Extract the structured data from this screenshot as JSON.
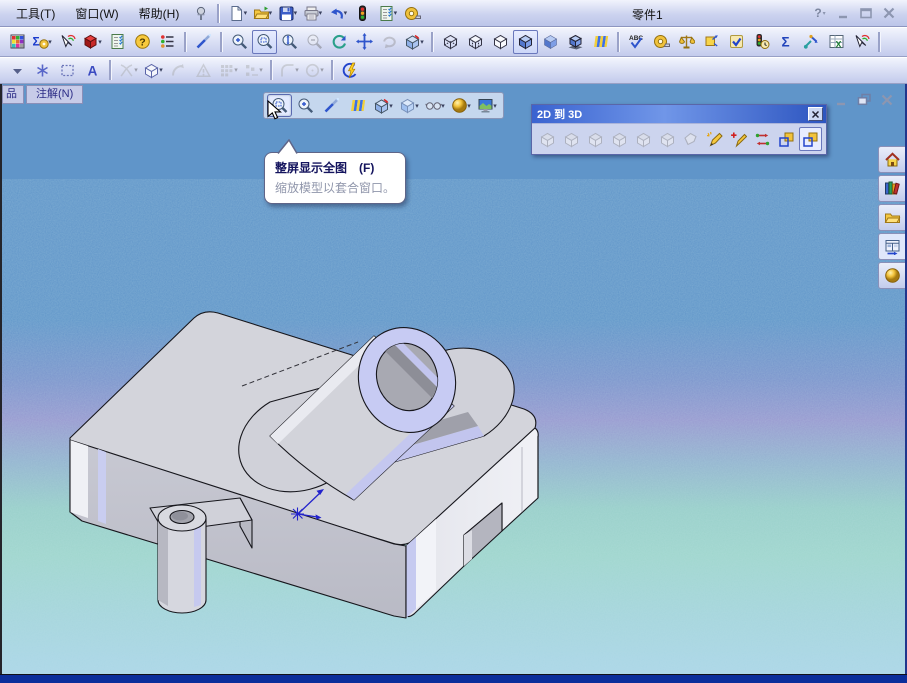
{
  "titlebar": {
    "title": "零件1",
    "menus": [
      {
        "label": "工具(T)"
      },
      {
        "label": "窗口(W)"
      },
      {
        "label": "帮助(H)"
      }
    ],
    "pin_icon": "pushpin",
    "window_buttons": [
      {
        "name": "help",
        "label": "?"
      },
      {
        "name": "minimize"
      },
      {
        "name": "maximize"
      },
      {
        "name": "close"
      }
    ]
  },
  "standard_toolbar": [
    {
      "icon": "new-doc",
      "dropdown": true
    },
    {
      "icon": "open-folder",
      "dropdown": true
    },
    {
      "icon": "save-floppy",
      "dropdown": true
    },
    {
      "icon": "print",
      "dropdown": true
    },
    {
      "icon": "undo",
      "dropdown": true
    },
    {
      "icon": "traffic-light"
    },
    {
      "icon": "checklist",
      "dropdown": true
    },
    {
      "icon": "tape-measure"
    }
  ],
  "view_toolbar": [
    {
      "icon": "color-palette"
    },
    {
      "icon": "measure-sigma",
      "dropdown": true
    },
    {
      "icon": "rainbow-pointer"
    },
    {
      "icon": "sw-cube",
      "dropdown": true
    },
    {
      "icon": "checklist"
    },
    {
      "icon": "help-question"
    },
    {
      "icon": "status-list"
    },
    {
      "sep": true
    },
    {
      "icon": "wand"
    },
    {
      "sep": true
    },
    {
      "icon": "zoom-area"
    },
    {
      "icon": "zoom-fit",
      "pressed": true
    },
    {
      "icon": "zoom-updown"
    },
    {
      "icon": "zoom-out",
      "disabled": true
    },
    {
      "icon": "refresh"
    },
    {
      "icon": "pan"
    },
    {
      "icon": "rotate",
      "disabled": true
    },
    {
      "icon": "section-cube",
      "dropdown": true
    },
    {
      "sep": true
    },
    {
      "icon": "cube-wireframe"
    },
    {
      "icon": "cube-hidden"
    },
    {
      "icon": "cube-nohidden"
    },
    {
      "icon": "cube-shaded-edges",
      "pressed": true
    },
    {
      "icon": "cube-shaded"
    },
    {
      "icon": "cube-shadow"
    },
    {
      "icon": "curvature-stripes"
    },
    {
      "sep": true
    },
    {
      "icon": "abc-spell"
    },
    {
      "icon": "tape-measure"
    },
    {
      "icon": "scales"
    },
    {
      "icon": "move-box"
    },
    {
      "icon": "checkbox"
    },
    {
      "icon": "traffic-clock"
    },
    {
      "icon": "sigma"
    },
    {
      "icon": "sensor-pointer"
    },
    {
      "icon": "excel-table"
    },
    {
      "icon": "rainbow-pointer"
    },
    {
      "sep": true
    }
  ],
  "sketch_toolbar": [
    {
      "icon": "lone-dropdown"
    },
    {
      "icon": "point-asterisk"
    },
    {
      "icon": "select-box"
    },
    {
      "icon": "text-A"
    },
    {
      "sep": true
    },
    {
      "icon": "trim",
      "disabled": true,
      "dropdown": true
    },
    {
      "icon": "cube-outline",
      "dropdown": true
    },
    {
      "icon": "convert",
      "disabled": true
    },
    {
      "icon": "warn",
      "disabled": true
    },
    {
      "icon": "pattern-dots",
      "disabled": true,
      "dropdown": true
    },
    {
      "icon": "step-pattern",
      "disabled": true,
      "dropdown": true
    },
    {
      "sep": true
    },
    {
      "icon": "fillet",
      "disabled": true,
      "dropdown": true
    },
    {
      "icon": "circle-tool",
      "disabled": true,
      "dropdown": true
    },
    {
      "sep": true
    },
    {
      "icon": "instant3d"
    }
  ],
  "command_tabs": [
    {
      "label": "品",
      "partial": true
    },
    {
      "label": "注解(N)"
    }
  ],
  "document_buttons": [
    {
      "name": "minimize"
    },
    {
      "name": "restore"
    },
    {
      "name": "close"
    }
  ],
  "headsup_toolbar": [
    {
      "icon": "zoom-fit",
      "pressed": true
    },
    {
      "icon": "zoom-area"
    },
    {
      "icon": "wand"
    },
    {
      "icon": "curvature-stripes"
    },
    {
      "icon": "section-cube",
      "dropdown": true
    },
    {
      "icon": "display-cube",
      "dropdown": true
    },
    {
      "icon": "glasses",
      "dropdown": true
    },
    {
      "icon": "appearance-ball",
      "dropdown": true
    },
    {
      "icon": "scene-screen",
      "dropdown": true
    }
  ],
  "panel_2d3d": {
    "title": "2D 到 3D",
    "buttons": [
      {
        "icon": "view-cube",
        "name": "view-front",
        "disabled": true
      },
      {
        "icon": "view-cube",
        "name": "view-top",
        "disabled": true
      },
      {
        "icon": "view-cube",
        "name": "view-right",
        "disabled": true
      },
      {
        "icon": "view-cube",
        "name": "view-left",
        "disabled": true
      },
      {
        "icon": "view-cube",
        "name": "view-bottom",
        "disabled": true
      },
      {
        "icon": "view-cube",
        "name": "view-back",
        "disabled": true
      },
      {
        "icon": "view-cube-aux",
        "name": "view-auxiliary",
        "disabled": true
      },
      {
        "icon": "sketch-pencil",
        "name": "create-sketch"
      },
      {
        "icon": "repair-pencil",
        "name": "repair-sketch"
      },
      {
        "icon": "align-arrows",
        "name": "align-sketch"
      },
      {
        "icon": "extrude-sketch",
        "name": "extrude"
      },
      {
        "icon": "extrude-sketch",
        "name": "extrude-selection",
        "pressed": true
      }
    ]
  },
  "tooltip": {
    "title": "整屏显示全图　(F)",
    "body": "缩放模型以套合窗口。"
  },
  "task_pane_tabs": [
    {
      "icon": "home",
      "name": "solidworks-resources"
    },
    {
      "icon": "design-library",
      "name": "design-library"
    },
    {
      "icon": "file-explorer",
      "name": "file-explorer"
    },
    {
      "icon": "view-palette",
      "name": "view-palette",
      "active": true
    },
    {
      "icon": "appearance-ball",
      "name": "appearances"
    }
  ],
  "colors": {
    "viewport_top": "#6095c9",
    "viewport_purple": "#9898d0",
    "viewport_teal": "#9fd6cd",
    "viewport_bottom": "#abd6e8",
    "model_grey": "#d3d4db",
    "ring_lavender": "#c7cbf3",
    "caption_blue": "#2d55c0",
    "bottom_strip": "#0b2e9b"
  }
}
